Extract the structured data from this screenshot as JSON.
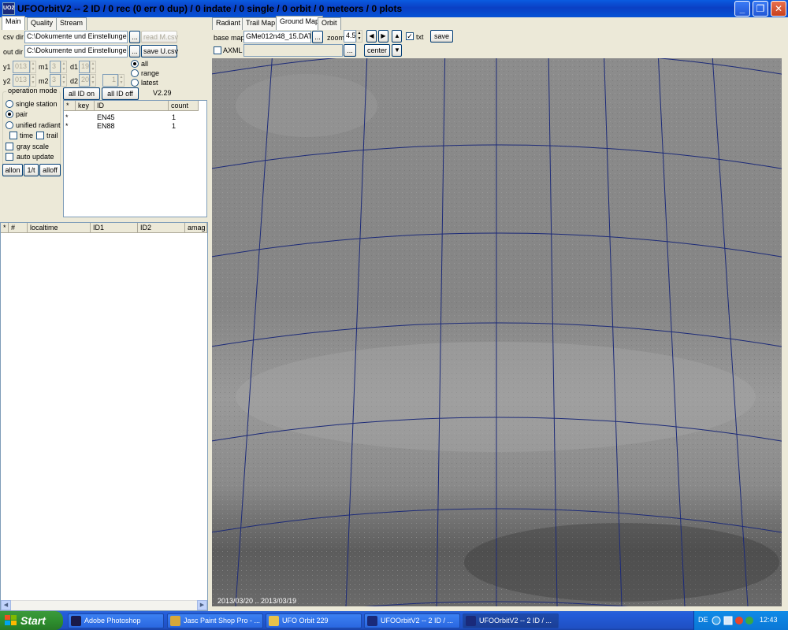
{
  "window": {
    "title": "UFOOrbitV2 -- 2 ID / 0 rec (0 err 0 dup) / 0 indate / 0 single / 0 orbit / 0 meteors / 0 plots",
    "app_icon_text": "UO2",
    "minimize": "_",
    "restore": "❐",
    "close": "✕"
  },
  "left_tabs": [
    "Main",
    "Quality",
    "Stream"
  ],
  "main": {
    "csv_dir_label": "csv dir",
    "csv_dir_value": "C:\\Dokumente und Einstellungen",
    "browse": "...",
    "read_m_csv": "read M.csv",
    "out_dir_label": "out dir",
    "out_dir_value": "C:\\Dokumente und Einstellungen",
    "save_u_csv": "save U.csv",
    "y1": "y1",
    "y1_value": "013",
    "m1": "m1",
    "m1_value": "3",
    "d1": "d1",
    "d1_value": "19",
    "y2": "y2",
    "y2_value": "013",
    "m2": "m2",
    "m2_value": "3",
    "d2": "d2",
    "d2_value": "20",
    "extra_value": "1",
    "radio_all": "all",
    "radio_range": "range",
    "radio_latest": "latest",
    "all_id_on": "all ID on",
    "all_id_off": "all ID off",
    "version": "V2.29",
    "opmode_legend": "operation mode",
    "single_station": "single station",
    "pair": "pair",
    "unified_radiant": "unified radiant",
    "time": "time",
    "trail": "trail",
    "gray_scale": "gray scale",
    "auto_update": "auto update",
    "allon": "allon",
    "onet": "1/t",
    "alloff": "alloff"
  },
  "id_list": {
    "headers": [
      "*",
      "key",
      "ID",
      "count"
    ],
    "rows": [
      {
        "star": "*",
        "key": "",
        "id": "EN45",
        "count": "1"
      },
      {
        "star": "*",
        "key": "",
        "id": "EN88",
        "count": "1"
      }
    ]
  },
  "event_list": {
    "headers": [
      "*",
      "#",
      "localtime",
      "ID1",
      "ID2",
      "amag"
    ]
  },
  "right_tabs": [
    "Radiant",
    "Trail Map",
    "Ground Map",
    "Orbit"
  ],
  "map_toolbar": {
    "base_map_label": "base map",
    "base_map_value": "GMe012n48_15.DAT",
    "browse": "...",
    "zoom_label": "zoom",
    "zoom_value": "4.5",
    "left": "◀",
    "right": "▶",
    "up": "▲",
    "down": "▼",
    "txt": "txt",
    "save": "save",
    "axml": "AXML",
    "center": "center"
  },
  "map": {
    "date_range": "2013/03/20 .. 2013/03/19",
    "grid_color": "#1c2a78"
  },
  "taskbar": {
    "start": "Start",
    "tasks": [
      {
        "label": "Adobe Photoshop",
        "icon_color": "#1a1a4a"
      },
      {
        "label": "Jasc Paint Shop Pro - ...",
        "icon_color": "#d7a83a"
      },
      {
        "label": "UFO Orbit 229",
        "icon_color": "#e8c24a"
      },
      {
        "label": "UFOOrbitV2 -- 2 ID / ...",
        "icon_color": "#1a2a7a"
      },
      {
        "label": "UFOOrbitV2 -- 2 ID / ...",
        "icon_color": "#1a2a7a"
      }
    ],
    "lang": "DE",
    "clock": "12:43"
  }
}
